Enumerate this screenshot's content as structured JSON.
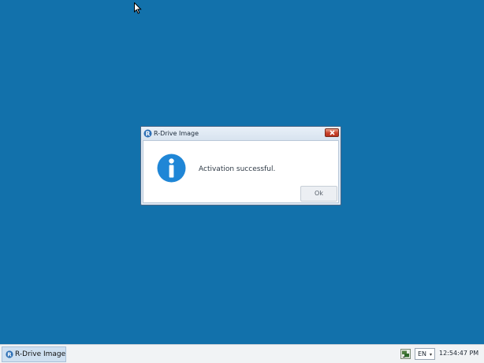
{
  "dialog": {
    "title": "R-Drive Image",
    "message": "Activation successful.",
    "ok_label": "Ok",
    "icon": "info-icon",
    "close_icon": "close-icon"
  },
  "taskbar": {
    "app_label": "R-Drive Image",
    "app_icon": "r-drive-icon",
    "tray_icon": "network-icon",
    "language": "EN",
    "language_arrow": "▾",
    "clock": "12:54:47 PM"
  },
  "colors": {
    "desktop": "#1271ab",
    "info_blue": "#1f86d6",
    "close_red": "#c8412a"
  }
}
